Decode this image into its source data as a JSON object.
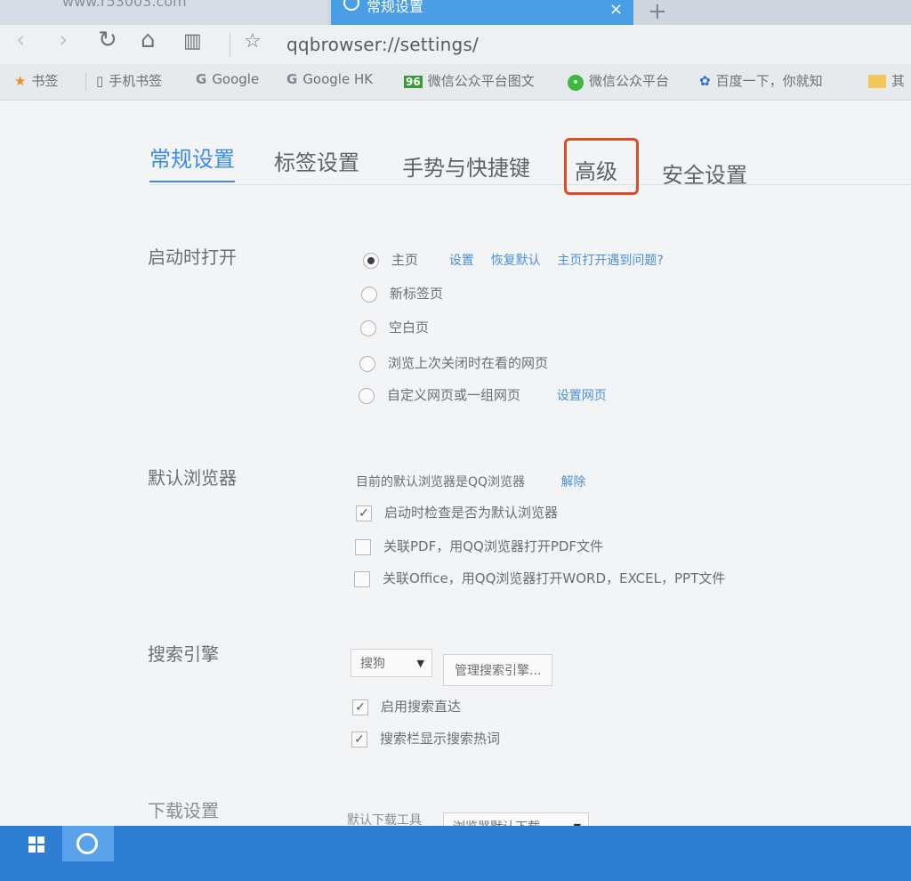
{
  "browser": {
    "inactive_tab_url": "www.r53003.com",
    "active_tab_title": "常规设置",
    "close_glyph": "×",
    "new_tab_glyph": "+",
    "address": "qqbrowser://settings/",
    "nav_icons": [
      "back-icon",
      "forward-icon",
      "refresh-icon",
      "home-icon",
      "reader-icon",
      "star-icon"
    ]
  },
  "bookmarks": [
    {
      "icon": "star-icon",
      "label": "书签"
    },
    {
      "icon": "phone-icon",
      "label": "手机书签"
    },
    {
      "icon": "google-icon",
      "label": "Google"
    },
    {
      "icon": "google-icon",
      "label": "Google HK"
    },
    {
      "icon": "96-icon",
      "label": "微信公众平台图文"
    },
    {
      "icon": "wechat-icon",
      "label": "微信公众平台"
    },
    {
      "icon": "baidu-icon",
      "label": "百度一下，你就知"
    },
    {
      "icon": "folder-icon",
      "label": "其"
    }
  ],
  "settings_tabs": [
    "常规设置",
    "标签设置",
    "手势与快捷键",
    "高级",
    "安全设置"
  ],
  "startup": {
    "label": "启动时打开",
    "options": [
      "主页",
      "新标签页",
      "空白页",
      "浏览上次关闭时在看的网页",
      "自定义网页或一组网页"
    ],
    "homepage_links": [
      "设置",
      "恢复默认",
      "主页打开遇到问题?"
    ],
    "custom_link": "设置网页"
  },
  "default_browser": {
    "label": "默认浏览器",
    "status": "目前的默认浏览器是QQ浏览器",
    "unbind_link": "解除",
    "checks": [
      "启动时检查是否为默认浏览器",
      "关联PDF，用QQ浏览器打开PDF文件",
      "关联Office，用QQ浏览器打开WORD，EXCEL，PPT文件"
    ]
  },
  "search": {
    "label": "搜索引擎",
    "engine": "搜狗",
    "manage_button": "管理搜索引擎...",
    "checks": [
      "启用搜索直达",
      "搜索栏显示搜索热词"
    ]
  },
  "download": {
    "label": "下载设置",
    "tool_label": "默认下载工具",
    "tool_value": "浏览器默认下载"
  },
  "colors": {
    "accent": "#3b8be2",
    "highlight": "#e24a2a",
    "taskbar": "#2e7fd3"
  }
}
